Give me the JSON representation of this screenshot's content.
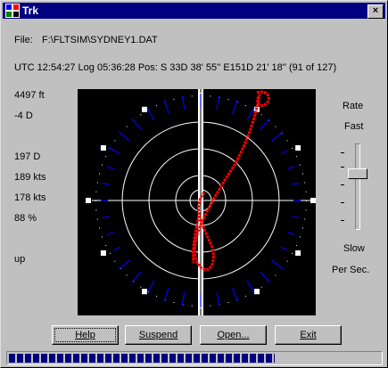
{
  "window": {
    "title": "Trk",
    "close_glyph": "×"
  },
  "file": {
    "label": "File:",
    "path": "F:\\FLTSIM\\SYDNEY1.DAT"
  },
  "status_line": "UTC 12:54:27 Log 05:36:28 Pos: S 33D 38' 55'' E151D 21' 18''  (91 of 127)",
  "readouts": {
    "altitude": "4497 ft",
    "vertical": "-4 D",
    "heading": "197 D",
    "airspeed": "189 kts",
    "groundspeed": "178 kts",
    "throttle": "88 %",
    "gear": "up"
  },
  "rate": {
    "title": "Rate",
    "fast": "Fast",
    "slow": "Slow",
    "unit": "Per Sec.",
    "level_fraction": 0.35
  },
  "buttons": {
    "help": "Help",
    "suspend": "Suspend",
    "open": "Open...",
    "exit": "Exit"
  },
  "progress": {
    "fraction": 0.717
  },
  "colors": {
    "track": "#ff0000",
    "wind": "#0000ff",
    "titlebar": "#000080"
  },
  "icons": {
    "app": "app-icon",
    "close": "close-icon"
  }
}
